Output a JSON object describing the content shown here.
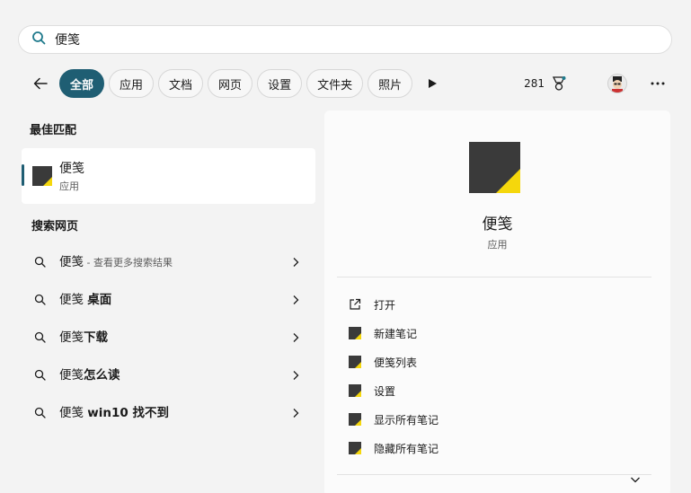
{
  "search": {
    "value": "便笺",
    "placeholder": ""
  },
  "filters": [
    "全部",
    "应用",
    "文档",
    "网页",
    "设置",
    "文件夹",
    "照片"
  ],
  "header_right": {
    "points": "281"
  },
  "sections": {
    "best_match": "最佳匹配",
    "search_web": "搜索网页"
  },
  "best_match": {
    "name": "便笺",
    "type": "应用"
  },
  "web_results": [
    {
      "prefix": "便笺",
      "bold": "",
      "hint": " - 查看更多搜索结果"
    },
    {
      "prefix": "便笺 ",
      "bold": "桌面",
      "hint": ""
    },
    {
      "prefix": "便笺",
      "bold": "下载",
      "hint": ""
    },
    {
      "prefix": "便笺",
      "bold": "怎么读",
      "hint": ""
    },
    {
      "prefix": "便笺 ",
      "bold": "win10 找不到",
      "hint": ""
    }
  ],
  "detail": {
    "name": "便笺",
    "type": "应用",
    "actions": [
      "打开",
      "新建笔记",
      "便笺列表",
      "设置",
      "显示所有笔记",
      "隐藏所有笔记"
    ]
  },
  "colors": {
    "accent": "#1f5e73",
    "note_yellow": "#f5d70c",
    "note_dark": "#3a3a3a"
  },
  "icons": {
    "search": "search-icon",
    "back": "back-arrow-icon",
    "play": "play-icon",
    "reward": "rewards-icon",
    "more": "more-icon",
    "open": "open-external-icon",
    "note": "sticky-note-icon",
    "chevron": "chevron-right-icon",
    "expand": "chevron-down-icon"
  }
}
